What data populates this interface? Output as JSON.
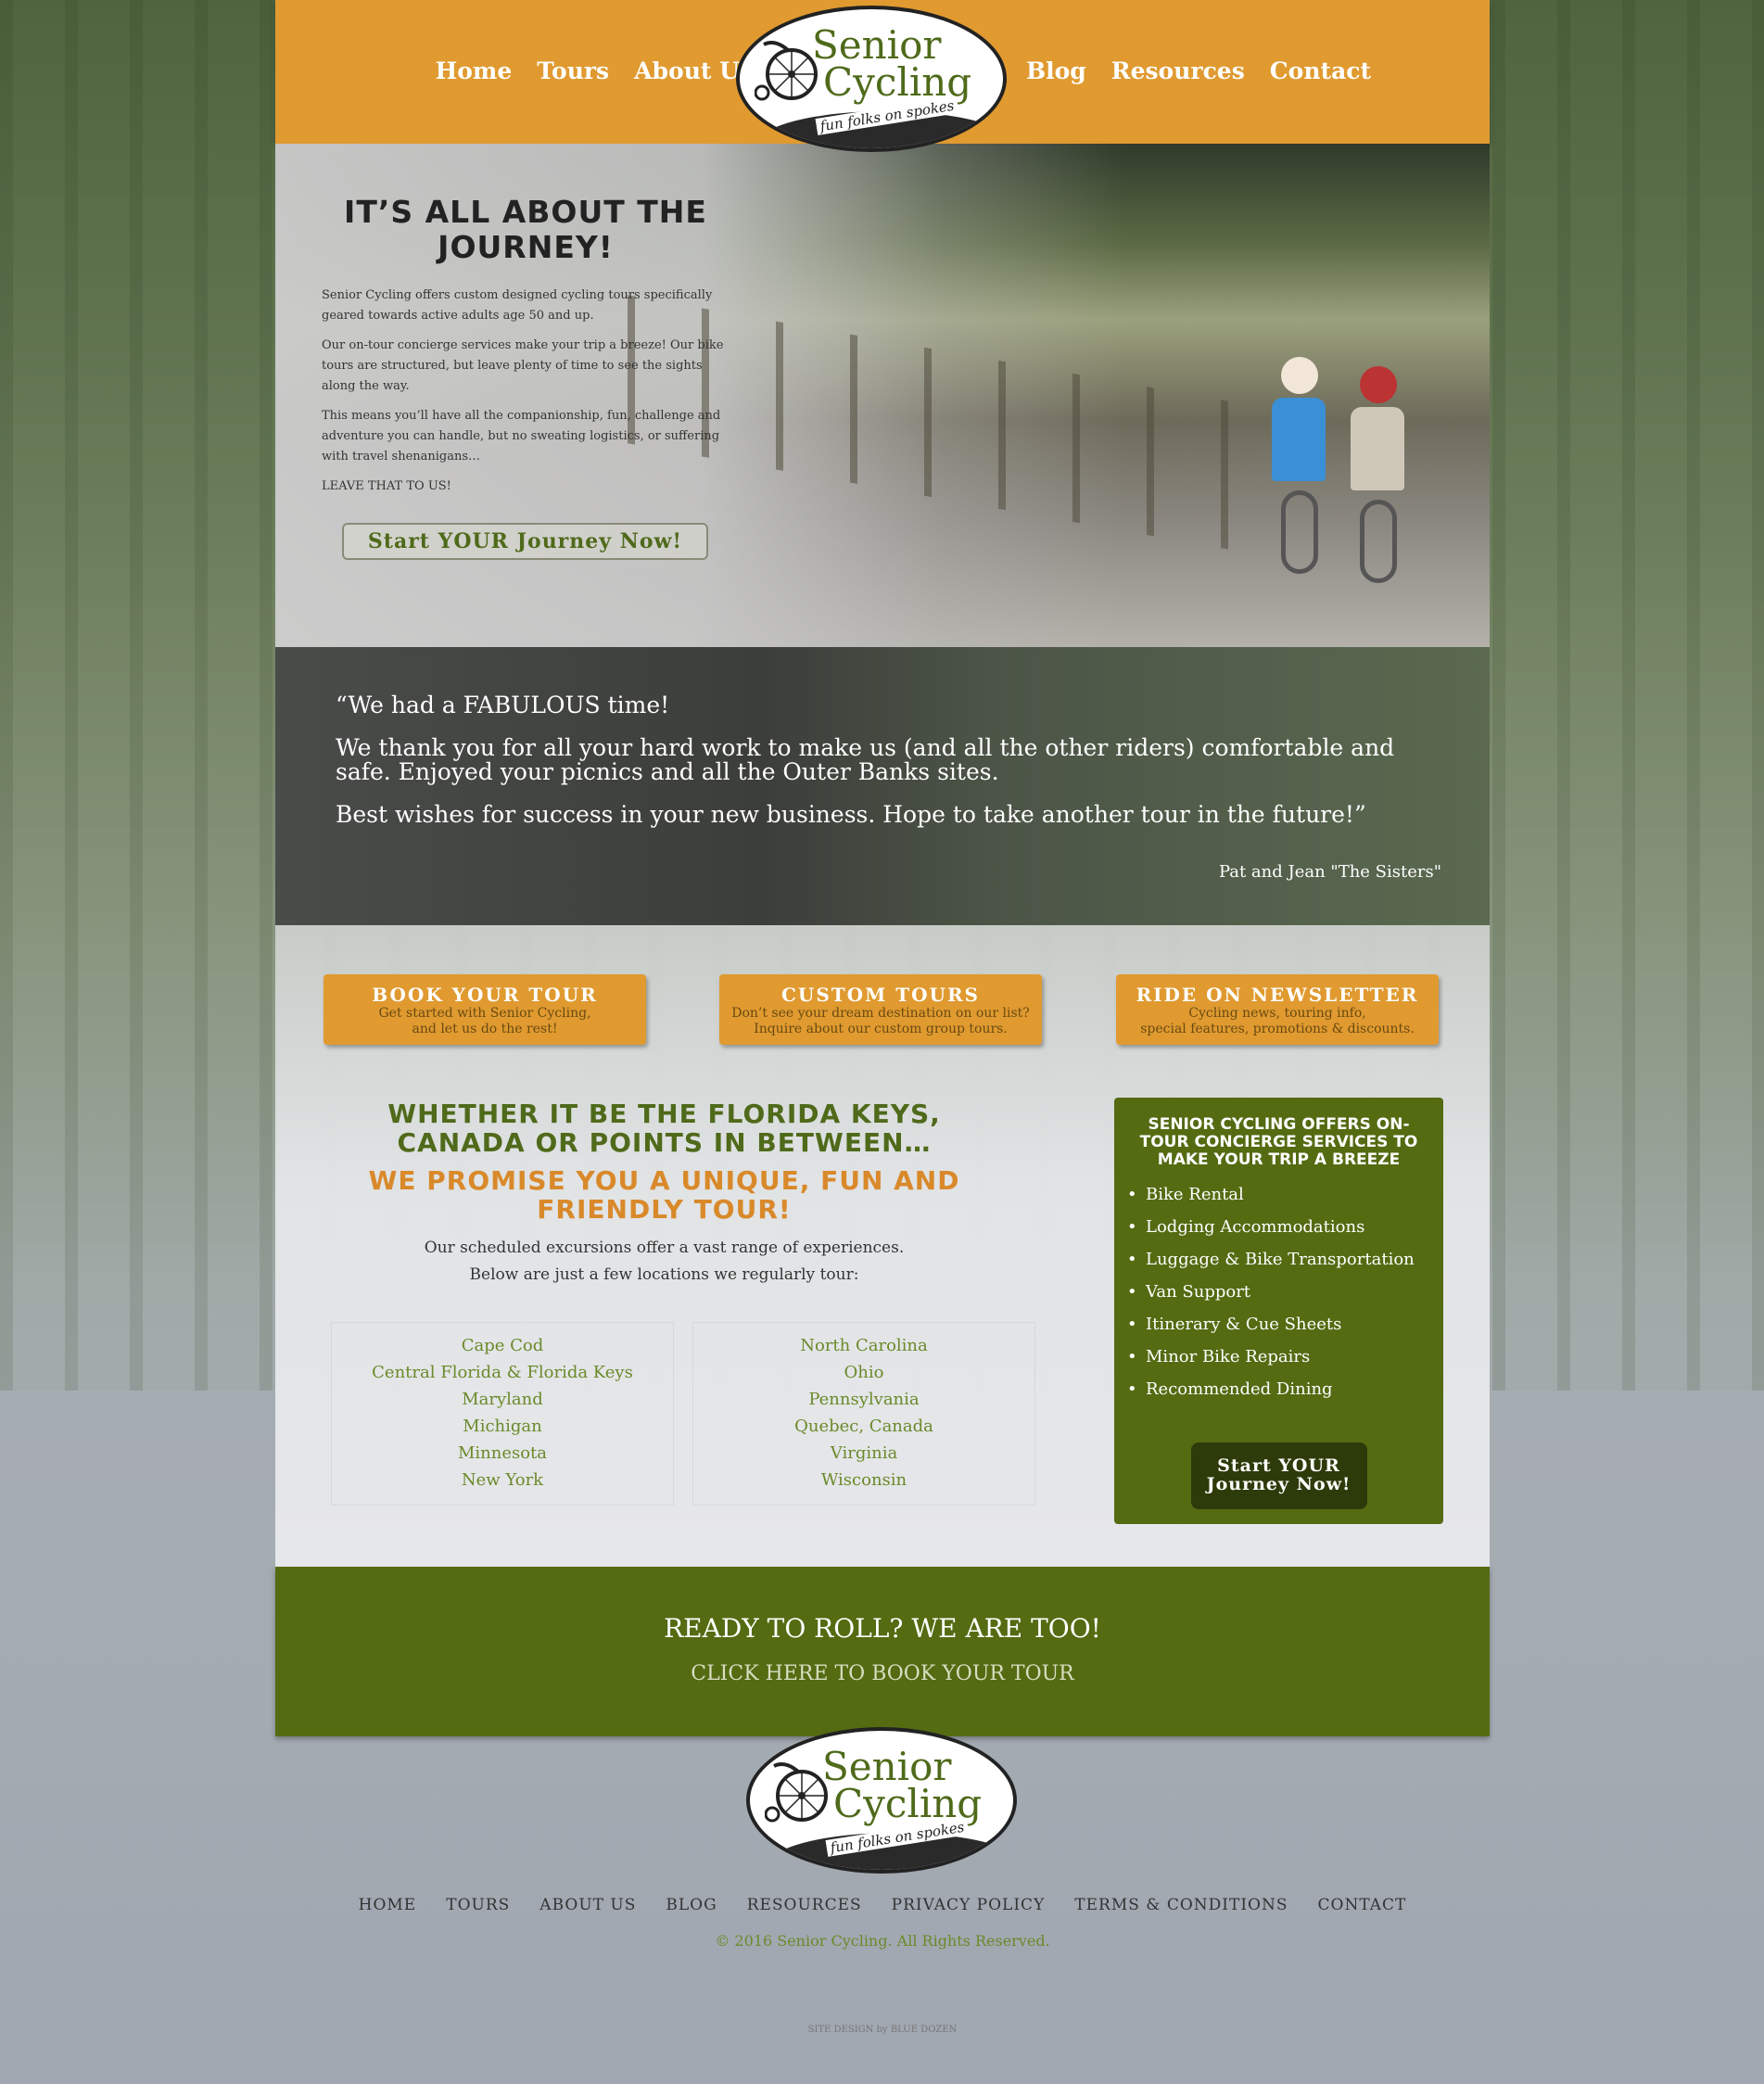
{
  "header": {
    "nav_left": [
      "Home",
      "Tours",
      "About Us"
    ],
    "nav_right": [
      "Blog",
      "Resources",
      "Contact"
    ],
    "logo": {
      "line1": "Senior",
      "line2": "Cycling",
      "tagline": "fun folks on spokes"
    },
    "bg_color": "#e09a30"
  },
  "hero": {
    "title": "IT’S ALL ABOUT THE JOURNEY!",
    "paragraphs": [
      "Senior Cycling offers custom designed cycling tours specifically geared towards active adults age 50 and up.",
      "Our on-tour concierge services make your trip a breeze! Our bike tours are structured, but leave plenty of time to see the sights along the way.",
      "This means you’ll have all the companionship, fun, challenge and adventure you can handle, but no sweating logistics, or suffering with travel shenanigans…",
      "LEAVE THAT TO US!"
    ],
    "button": "Start YOUR Journey Now!"
  },
  "testimonial": {
    "lines": [
      "“We had a FABULOUS time!",
      "We thank you for all your hard work to make us (and all the other riders) comfortable and safe. Enjoyed your picnics and all the Outer Banks sites.",
      "Best wishes for success in your new business. Hope to take another tour in the future!”"
    ],
    "author": "Pat and Jean \"The Sisters\""
  },
  "cta_boxes": [
    {
      "title": "BOOK YOUR TOUR",
      "sub1": "Get started with Senior Cycling,",
      "sub2": "and let us do the rest!"
    },
    {
      "title": "CUSTOM TOURS",
      "sub1": "Don’t see your dream destination on our list?",
      "sub2": "Inquire about our custom group tours."
    },
    {
      "title": "RIDE ON NEWSLETTER",
      "sub1": "Cycling news, touring info,",
      "sub2": "special features, promotions & discounts."
    }
  ],
  "promo": {
    "heading": "WHETHER IT BE THE FLORIDA KEYS, CANADA OR POINTS IN BETWEEN…",
    "subheading": "WE PROMISE YOU A UNIQUE, FUN AND FRIENDLY TOUR!",
    "intro1": "Our scheduled excursions offer a vast range of experiences.",
    "intro2": "Below are just a few locations we regularly tour:",
    "locations_left": [
      "Cape Cod",
      "Central Florida & Florida Keys",
      "Maryland",
      "Michigan",
      "Minnesota",
      "New York"
    ],
    "locations_right": [
      "North Carolina",
      "Ohio",
      "Pennsylvania",
      "Quebec, Canada",
      "Virginia",
      "Wisconsin"
    ]
  },
  "services": {
    "heading": "SENIOR CYCLING OFFERS ON-TOUR CONCIERGE SERVICES TO MAKE YOUR TRIP A BREEZE",
    "items": [
      "Bike Rental",
      "Lodging Accommodations",
      "Luggage & Bike Transportation",
      "Van Support",
      "Itinerary & Cue Sheets",
      "Minor Bike Repairs",
      "Recommended Dining"
    ],
    "button_line1": "Start YOUR",
    "button_line2": "Journey Now!"
  },
  "ready": {
    "title": "READY TO ROLL? WE ARE TOO!",
    "link": "CLICK HERE TO BOOK YOUR TOUR"
  },
  "footer": {
    "nav": [
      "HOME",
      "TOURS",
      "ABOUT US",
      "BLOG",
      "RESOURCES",
      "PRIVACY POLICY",
      "TERMS & CONDITIONS",
      "CONTACT"
    ],
    "copyright": "© 2016 Senior Cycling. All Rights Reserved.",
    "credit": "SITE DESIGN by BLUE DOZEN"
  }
}
